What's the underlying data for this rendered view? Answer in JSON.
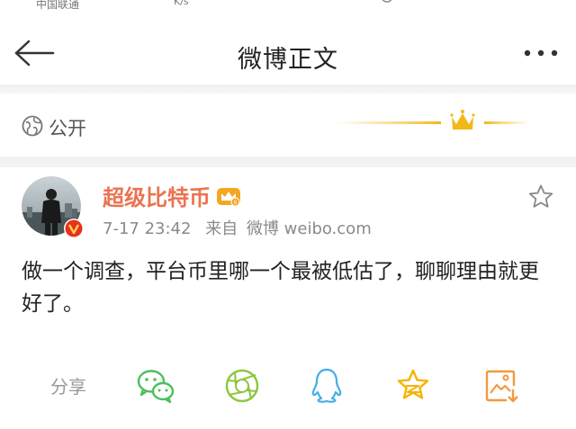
{
  "status_bar": {
    "carrier": "中国联通",
    "net_speed": "K/s"
  },
  "header": {
    "back_icon": "back-arrow-icon",
    "title": "微博正文",
    "more_icon": "more-dots-icon"
  },
  "visibility": {
    "icon": "globe-icon",
    "label": "公开"
  },
  "post": {
    "username": "超级比特币",
    "username_color": "#eb7350",
    "timestamp": "7-17 23:42",
    "source_prefix": "来自",
    "source_app": "微博 weibo.com",
    "text": "做一个调查，平台币里哪一个最被低估了，聊聊理由就更好了。",
    "favorite_icon": "star-outline-icon"
  },
  "share": {
    "label": "分享",
    "targets": [
      {
        "name": "wechat",
        "icon": "wechat-icon",
        "color": "#4cbf5c"
      },
      {
        "name": "moments",
        "icon": "moments-icon",
        "color": "#8cc63f"
      },
      {
        "name": "qq",
        "icon": "qq-icon",
        "color": "#45aee8"
      },
      {
        "name": "qzone",
        "icon": "qzone-star-icon",
        "color": "#f5b400"
      },
      {
        "name": "save-image",
        "icon": "save-image-icon",
        "color": "#f19a3e"
      }
    ]
  }
}
